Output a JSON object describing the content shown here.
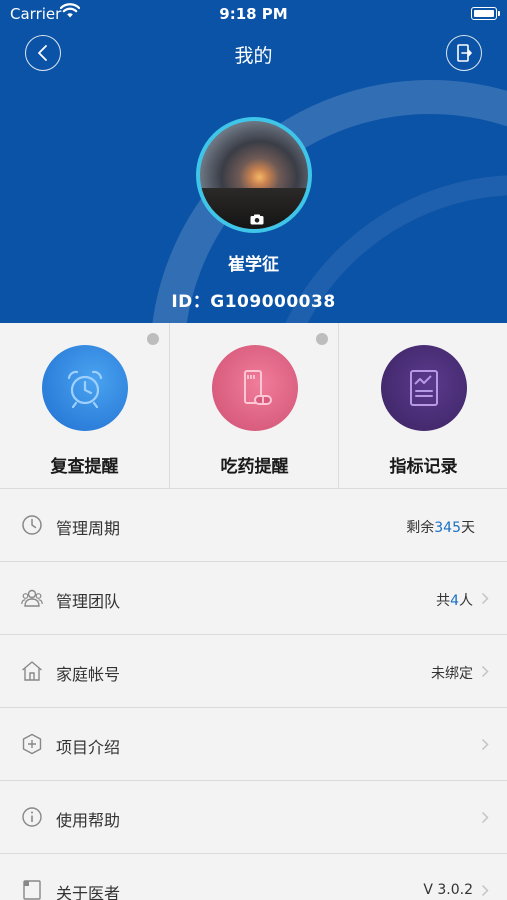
{
  "status": {
    "carrier": "Carrier",
    "time": "9:18 PM"
  },
  "nav": {
    "title": "我的",
    "back_icon": "back-icon",
    "logout_icon": "logout-icon"
  },
  "profile": {
    "name": "崔学征",
    "id": "ID：G109000038"
  },
  "tiles": [
    {
      "label": "复查提醒",
      "icon": "alarm-clock-icon",
      "color": "#2f86e0",
      "badge": true
    },
    {
      "label": "吃药提醒",
      "icon": "medicine-icon",
      "color": "#e06888",
      "badge": true
    },
    {
      "label": "指标记录",
      "icon": "chart-record-icon",
      "color": "#4b2e7a",
      "badge": false
    }
  ],
  "list": [
    {
      "title": "管理周期",
      "value_prefix": "剩余",
      "value_highlight": "345",
      "value_suffix": "天",
      "icon": "clock-icon",
      "chevron": false
    },
    {
      "title": "管理团队",
      "value_prefix": "共",
      "value_highlight": "4",
      "value_suffix": "人",
      "icon": "team-icon",
      "chevron": true
    },
    {
      "title": "家庭帐号",
      "value_prefix": "未绑定",
      "value_highlight": "",
      "value_suffix": "",
      "icon": "home-icon",
      "chevron": true
    },
    {
      "title": "项目介绍",
      "value_prefix": "",
      "value_highlight": "",
      "value_suffix": "",
      "icon": "plus-shield-icon",
      "chevron": true
    },
    {
      "title": "使用帮助",
      "value_prefix": "",
      "value_highlight": "",
      "value_suffix": "",
      "icon": "info-icon",
      "chevron": true
    },
    {
      "title": "关于医者",
      "value_prefix": "V 3.0.2",
      "value_highlight": "",
      "value_suffix": "",
      "icon": "about-icon",
      "chevron": true
    }
  ],
  "colors": {
    "header": "#0b53a6",
    "avatar_ring": "#3ec5e8",
    "highlight": "#1a6fc2"
  }
}
